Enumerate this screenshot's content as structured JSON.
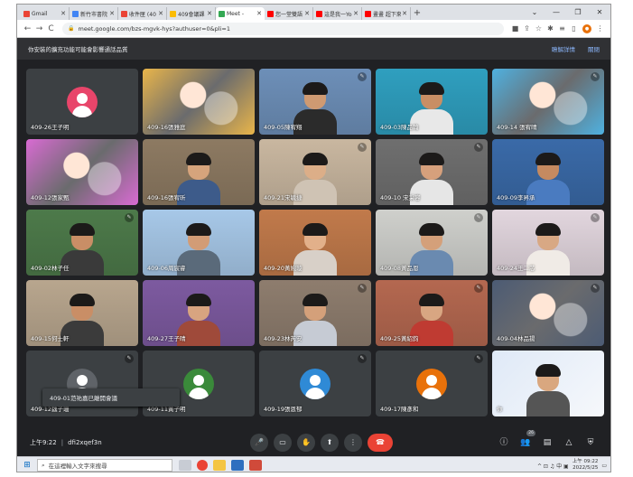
{
  "tabs": [
    {
      "label": "Gmail",
      "favicon": "#ea4335",
      "active": false
    },
    {
      "label": "新竹市書院",
      "favicon": "#4285f4",
      "active": false
    },
    {
      "label": "收件匣 (40",
      "favicon": "#ea4335",
      "active": false
    },
    {
      "label": "409會議課",
      "favicon": "#fbbc04",
      "active": false
    },
    {
      "label": "Meet -",
      "favicon": "#34a853",
      "active": true
    },
    {
      "label": "您一堂雙語",
      "favicon": "#ff0000",
      "active": false
    },
    {
      "label": "這是我一Yo",
      "favicon": "#ff0000",
      "active": false
    },
    {
      "label": "畫畫 超下來",
      "favicon": "#ff0000",
      "active": false
    }
  ],
  "newtab": "+",
  "window_controls": [
    "⌄",
    "—",
    "❐",
    "✕"
  ],
  "url": "meet.google.com/bzs-mgvk-hys?authuser=0&pli=1",
  "banner": {
    "text": "你安裝的擴充功能可能會影響通話品質",
    "details": "瞭解詳情",
    "close": "關閉"
  },
  "participants": [
    {
      "name": "409-26王子明",
      "type": "avatar",
      "initial": "",
      "color": "#e8456a",
      "muted": false
    },
    {
      "name": "409-16張雅庭",
      "type": "anime",
      "bg": "#e9b54a",
      "muted": false
    },
    {
      "name": "409-05陳宥翔",
      "type": "video",
      "bg": "#6d8fb8",
      "skin": "#cf9a72",
      "shirt": "#2b2b2b",
      "muted": true
    },
    {
      "name": "409-03陳品翰",
      "type": "video",
      "bg": "#2f9fbf",
      "skin": "#c98e64",
      "shirt": "#e8e8e8",
      "muted": false
    },
    {
      "name": "409-14 張宥晴",
      "type": "anime",
      "bg": "#4fb1e0",
      "muted": true
    },
    {
      "name": "409-12張家甄",
      "type": "anime",
      "bg": "#d86bd2",
      "muted": false
    },
    {
      "name": "409-16張宥昕",
      "type": "video",
      "bg": "#8d7a62",
      "skin": "#d6a47c",
      "shirt": "#3d5b8a",
      "muted": false
    },
    {
      "name": "409-21宋毓捷",
      "type": "video",
      "bg": "#c9b7a0",
      "skin": "#dcae88",
      "shirt": "#cfc3b4",
      "muted": true
    },
    {
      "name": "409-10 宋采容",
      "type": "video",
      "bg": "#6f6f6f",
      "skin": "#d6a07c",
      "shirt": "#e6e6e6",
      "muted": true
    },
    {
      "name": "409-09李昇承",
      "type": "video",
      "bg": "#3a6aa8",
      "skin": "#c58a60",
      "shirt": "#4a7bc0",
      "muted": false
    },
    {
      "name": "409-02林子任",
      "type": "video",
      "bg": "#4d7a4a",
      "skin": "#c98e66",
      "shirt": "#3a3a3a",
      "muted": true
    },
    {
      "name": "409-06周宸睿",
      "type": "video",
      "bg": "#a7c8e8",
      "skin": "#d29c76",
      "shirt": "#5a6a7a",
      "muted": false
    },
    {
      "name": "409-20黃婉璇",
      "type": "video",
      "bg": "#c17a4b",
      "skin": "#e2b08a",
      "shirt": "#d8d0c8",
      "muted": false
    },
    {
      "name": "409-08黃品恩",
      "type": "video",
      "bg": "#cfd0cc",
      "skin": "#d4a07a",
      "shirt": "#6a8ab0",
      "muted": true
    },
    {
      "name": "409-24王二芯",
      "type": "video",
      "bg": "#e2d6de",
      "skin": "#d8a884",
      "shirt": "#f0ebe6",
      "muted": true
    },
    {
      "name": "409-15何士軒",
      "type": "video",
      "bg": "#b8a68e",
      "skin": "#c98e66",
      "shirt": "#3b3b3b",
      "muted": false
    },
    {
      "name": "409-27王子晴",
      "type": "video",
      "bg": "#7d5aa0",
      "skin": "#d8a480",
      "shirt": "#9f4a3a",
      "muted": false
    },
    {
      "name": "409-23林芮安",
      "type": "video",
      "bg": "#8e7d6e",
      "skin": "#d4a07a",
      "shirt": "#c6cbd4",
      "muted": true
    },
    {
      "name": "409-25黃紹鈞",
      "type": "video",
      "bg": "#b46850",
      "skin": "#d8a682",
      "shirt": "#bf3b32",
      "muted": true
    },
    {
      "name": "409-04林品揚",
      "type": "anime",
      "bg": "#4c5b74",
      "muted": true
    },
    {
      "name": "409-12魏子珊",
      "type": "avatar",
      "initial": "",
      "color": "#5f6368",
      "muted": true
    },
    {
      "name": "409-11黃子明",
      "type": "avatar",
      "initial": "",
      "color": "#3a8a3a",
      "muted": false
    },
    {
      "name": "409-19張恩郁",
      "type": "avatar",
      "initial": "",
      "color": "#2f8ad6",
      "muted": true
    },
    {
      "name": "409-17陳彥和",
      "type": "avatar",
      "initial": "",
      "color": "#e8710a",
      "muted": true
    },
    {
      "name": "你",
      "type": "self",
      "bg": "#e8eef8",
      "muted": false
    }
  ],
  "tooltip": "409-01范祐嘉已離開會議",
  "meeting": {
    "time": "上午9:22",
    "code": "dfi2xqef3n"
  },
  "controls": [
    {
      "name": "mic-button",
      "icon": "🎤"
    },
    {
      "name": "camera-button",
      "icon": "▭"
    },
    {
      "name": "raise-hand-button",
      "icon": "✋"
    },
    {
      "name": "present-button",
      "icon": "⬆"
    },
    {
      "name": "more-options-button",
      "icon": "⋮"
    },
    {
      "name": "end-call-button",
      "icon": "☎"
    }
  ],
  "right_controls": [
    {
      "name": "info-button",
      "icon": "ⓘ",
      "badge": ""
    },
    {
      "name": "people-button",
      "icon": "👥",
      "badge": "26"
    },
    {
      "name": "chat-button",
      "icon": "▤",
      "badge": ""
    },
    {
      "name": "activities-button",
      "icon": "△",
      "badge": ""
    },
    {
      "name": "host-controls-button",
      "icon": "⛨",
      "badge": ""
    }
  ],
  "taskbar": {
    "search_placeholder": "在這裡輸入文字來搜尋",
    "tray_text": "^ ⊡ ♫ 中 ▣",
    "time": "上午 09:22",
    "date": "2022/5/25"
  }
}
